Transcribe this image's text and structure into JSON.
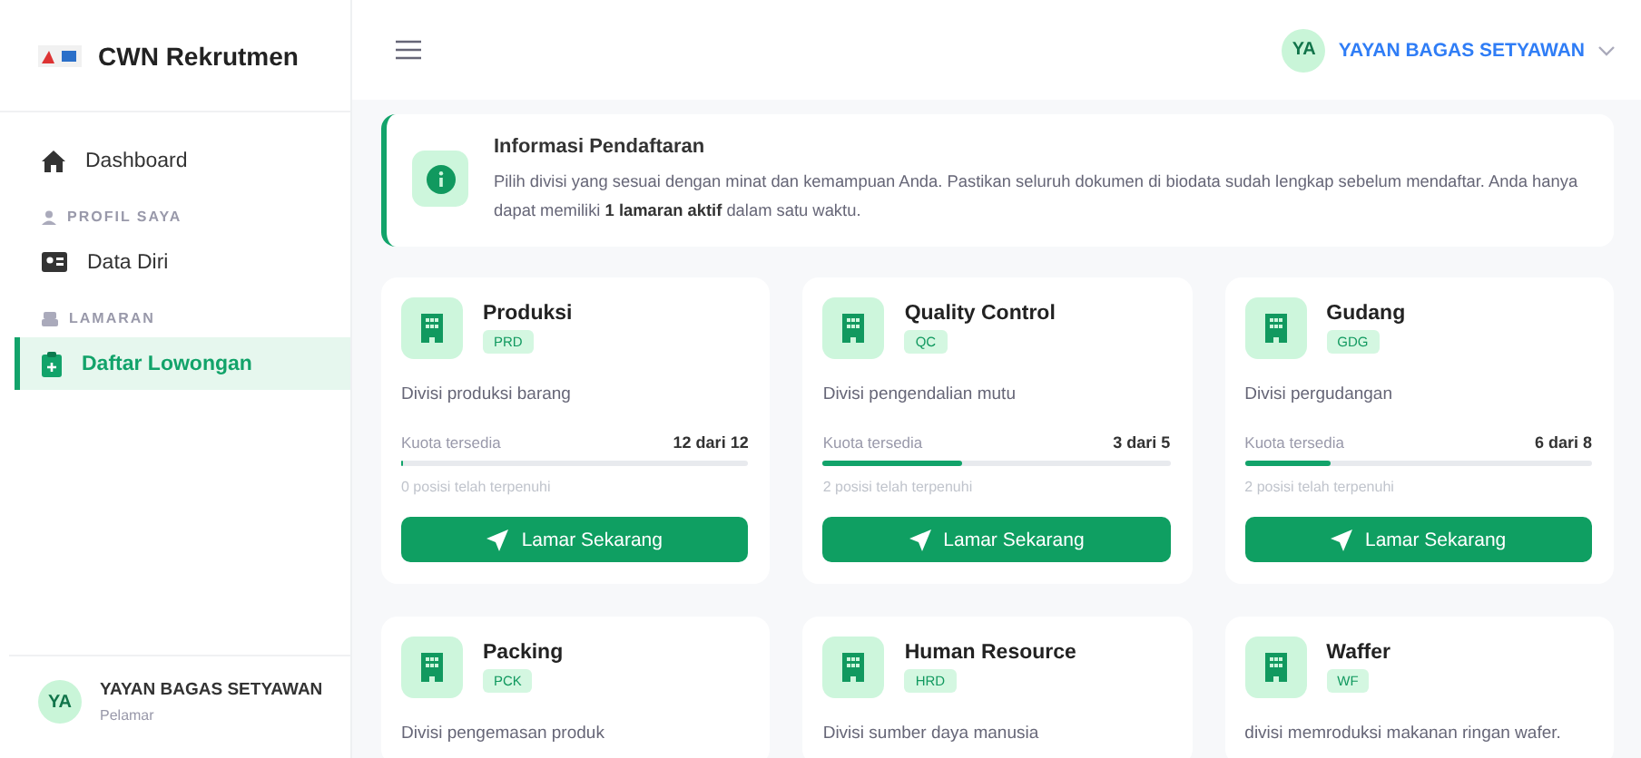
{
  "brand": {
    "name": "CWN Rekrutmen"
  },
  "sidebar": {
    "items": [
      {
        "kind": "link",
        "label": "Dashboard",
        "selected": false
      },
      {
        "kind": "section",
        "label": "PROFIL SAYA"
      },
      {
        "kind": "link",
        "label": "Data Diri",
        "selected": false
      },
      {
        "kind": "section",
        "label": "LAMARAN"
      },
      {
        "kind": "link",
        "label": "Daftar Lowongan",
        "selected": true
      }
    ]
  },
  "sidebar_user": {
    "initials": "YA",
    "name": "YAYAN BAGAS SETYAWAN",
    "role": "Pelamar"
  },
  "header": {
    "initials": "YA",
    "user_name": "YAYAN BAGAS SETYAWAN"
  },
  "info": {
    "title": "Informasi Pendaftaran",
    "text": "Pilih divisi yang sesuai dengan minat dan kemampuan Anda. Pastikan seluruh dokumen di biodata sudah lengkap sebelum mendaftar. Anda hanya dapat memiliki **1 lamaran aktif** dalam satu waktu."
  },
  "divisions": [
    {
      "name": "Produksi",
      "code": "PRD",
      "description": "Divisi produksi barang",
      "quota_label": "Kuota tersedia",
      "quota": "12 dari 12",
      "level": 0,
      "filled_note": "0 posisi telah terpenuhi",
      "button": "Lamar Sekarang"
    },
    {
      "name": "Quality Control",
      "code": "QC",
      "description": "Divisi pengendalian mutu",
      "quota_label": "Kuota tersedia",
      "quota": "3 dari 5",
      "level": 0.4,
      "filled_note": "2 posisi telah terpenuhi",
      "button": "Lamar Sekarang"
    },
    {
      "name": "Gudang",
      "code": "GDG",
      "description": "Divisi pergudangan",
      "quota_label": "Kuota tersedia",
      "quota": "6 dari 8",
      "level": 0.25,
      "filled_note": "2 posisi telah terpenuhi",
      "button": "Lamar Sekarang"
    },
    {
      "name": "Packing",
      "code": "PCK",
      "description": "Divisi pengemasan produk"
    },
    {
      "name": "Human Resource",
      "code": "HRD",
      "description": "Divisi sumber daya manusia"
    },
    {
      "name": "Waffer",
      "code": "WF",
      "description": "divisi memroduksi makanan ringan wafer."
    }
  ]
}
